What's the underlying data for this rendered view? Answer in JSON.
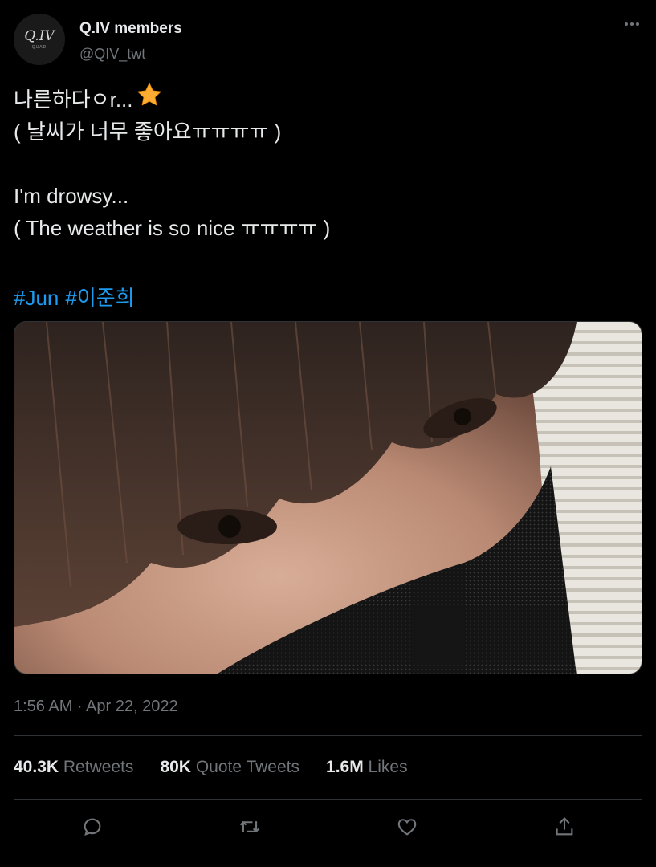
{
  "author": {
    "display_name": "Q.IV members",
    "handle": "@QIV_twt",
    "avatar_text": "Q.IV",
    "avatar_subtext": "QUAD"
  },
  "tweet": {
    "lines": [
      "나른하다ㅇr...",
      "( 날씨가 너무 좋아요ㅠㅠㅠㅠ )",
      "",
      "I'm drowsy...",
      "( The weather is so nice ㅠㅠㅠㅠ )"
    ],
    "emoji": "star-emoji",
    "hashtags": [
      "#Jun",
      "#이준희"
    ]
  },
  "media": {
    "description_icon": "photo"
  },
  "timestamp": "1:56 AM · Apr 22, 2022",
  "stats": {
    "retweets_count": "40.3K",
    "retweets_label": "Retweets",
    "quotes_count": "80K",
    "quotes_label": "Quote Tweets",
    "likes_count": "1.6M",
    "likes_label": "Likes"
  },
  "actions": [
    "reply-icon",
    "retweet-icon",
    "like-icon",
    "share-icon"
  ],
  "colors": {
    "background": "#000000",
    "text": "#e7e9ea",
    "muted": "#71767b",
    "link": "#1d9bf0",
    "divider": "#2f3336",
    "star": "#ffac33"
  }
}
